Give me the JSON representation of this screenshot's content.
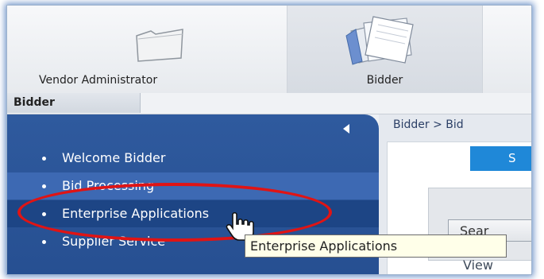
{
  "module_tabs": [
    {
      "label": "Vendor Administrator",
      "icon": "folder-icon"
    },
    {
      "label": "Bidder",
      "icon": "documents-icon"
    }
  ],
  "subtab": {
    "label": "Bidder"
  },
  "sidebar": {
    "collapse_icon": "triangle-left-icon",
    "items": [
      {
        "label": "Welcome Bidder"
      },
      {
        "label": "Bid Processing"
      },
      {
        "label": "Enterprise Applications"
      },
      {
        "label": "Supplier Service"
      }
    ]
  },
  "breadcrumb": {
    "text": "Bidder  >  Bid"
  },
  "content": {
    "button_label": "S",
    "search_tab_label": "Sear",
    "view_label": "View"
  },
  "tooltip": {
    "text": "Enterprise Applications"
  },
  "colors": {
    "sidebar_bg": "#2f5a9e",
    "sidebar_active": "#1d4585",
    "highlight_ring": "#e01414",
    "button_blue": "#1f88d8",
    "tooltip_bg": "#ffffe9"
  }
}
